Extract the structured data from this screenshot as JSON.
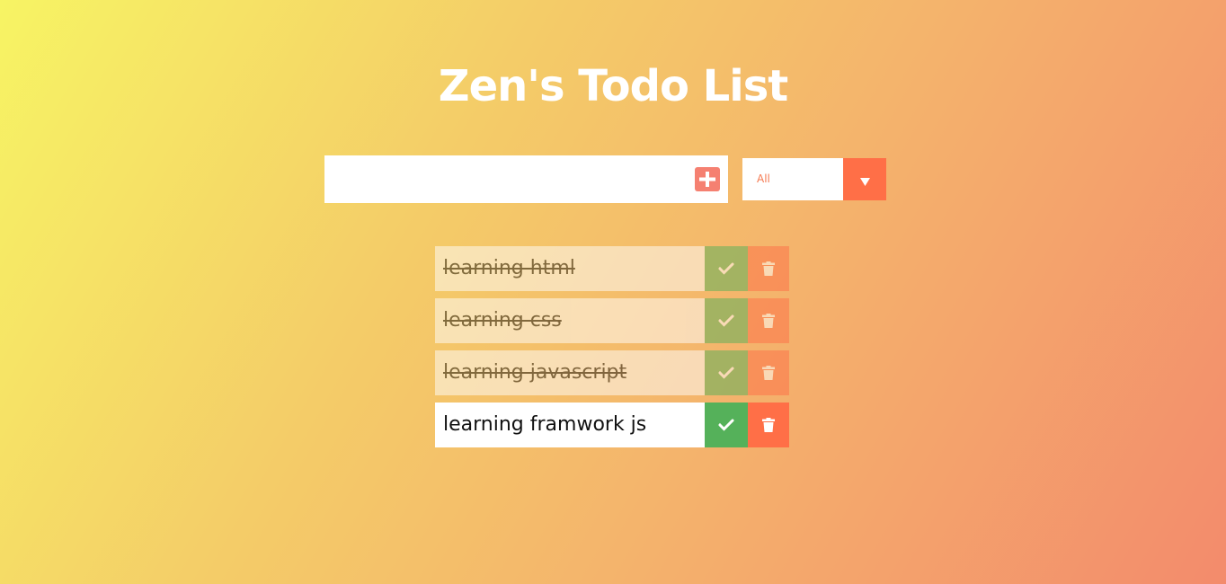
{
  "app": {
    "title": "Zen's Todo List"
  },
  "form": {
    "input_value": "",
    "input_placeholder": "",
    "add_icon": "plus-square-icon",
    "filter": {
      "selected": "All",
      "arrow_icon": "caret-down-icon"
    }
  },
  "todos": [
    {
      "text": "learning html",
      "completed": true
    },
    {
      "text": "learning css",
      "completed": true
    },
    {
      "text": "learning javascript",
      "completed": true
    },
    {
      "text": "learning framwork js",
      "completed": false
    }
  ],
  "colors": {
    "background_start": "#f7f464",
    "background_end": "#f38b6c",
    "accent": "#ff6f47",
    "check": "#55b15a",
    "add_button": "#f58071"
  }
}
